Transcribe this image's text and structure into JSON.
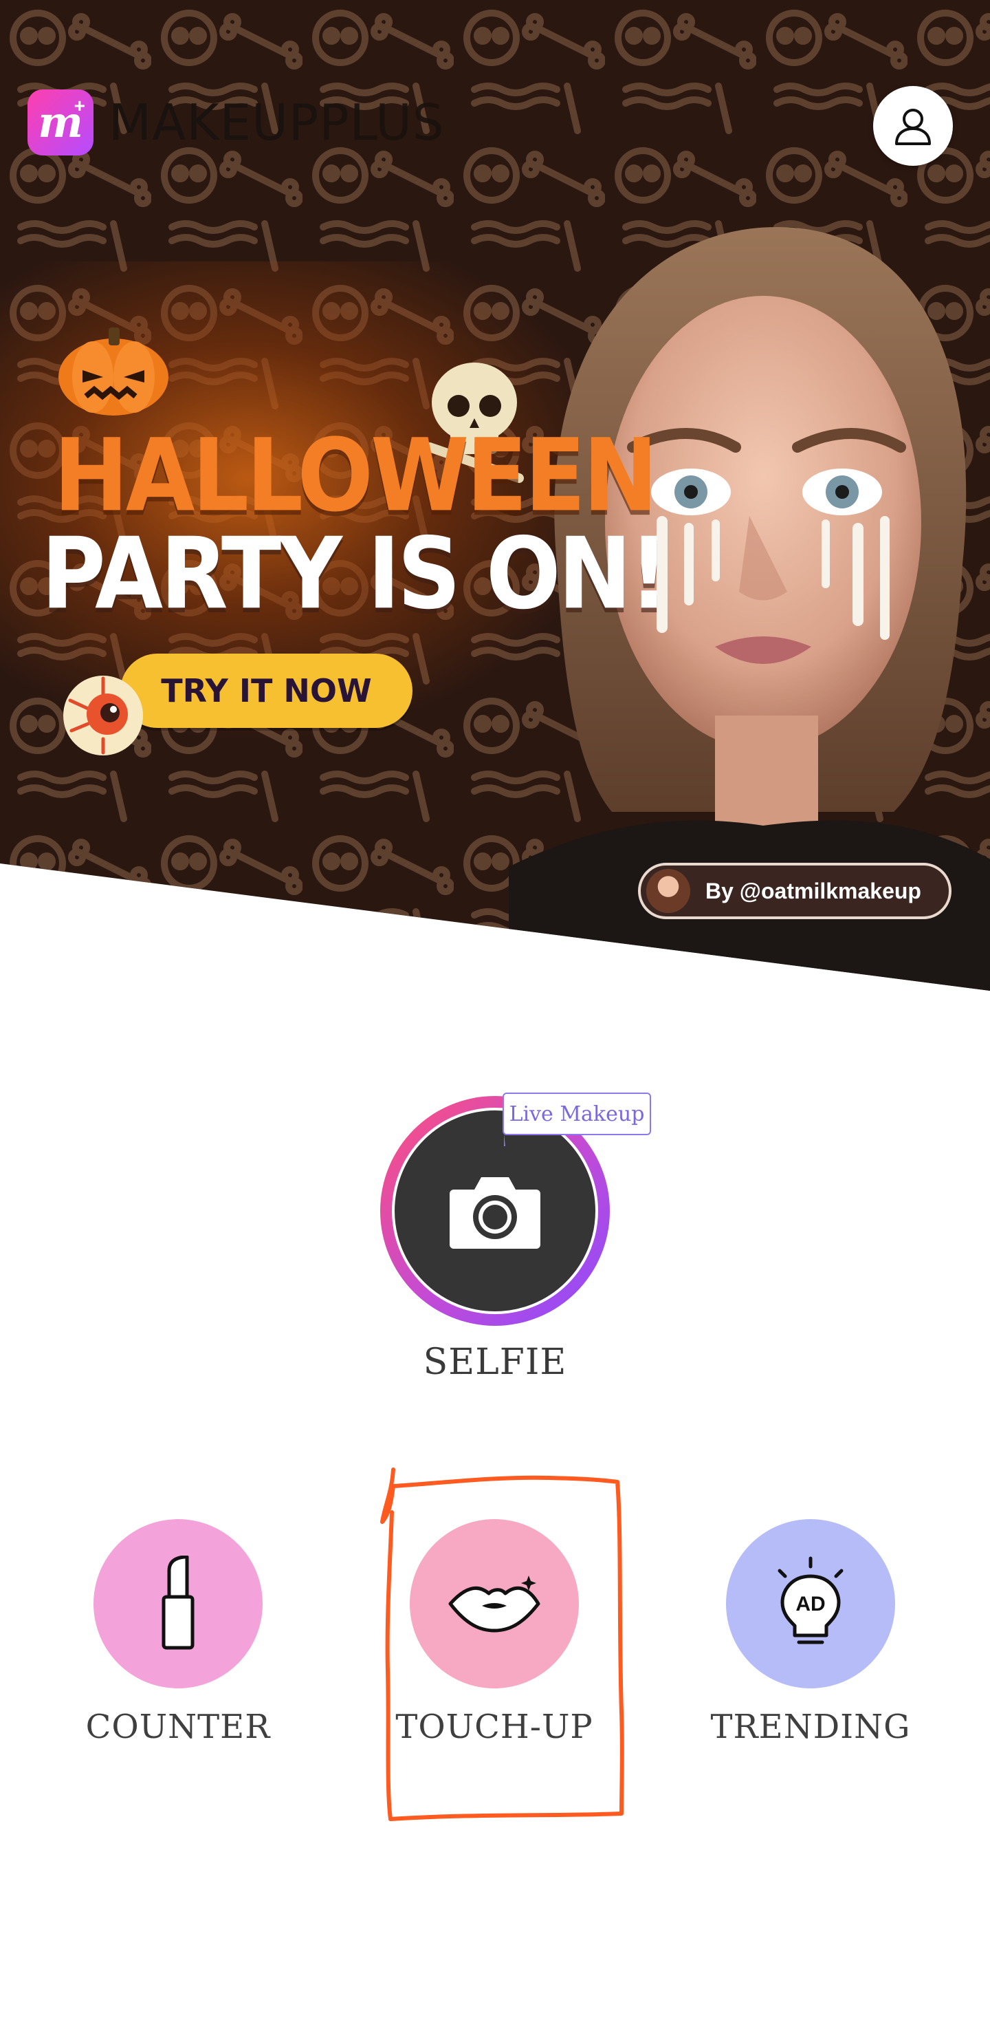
{
  "brand": {
    "mark": "m+",
    "name_bold": "MAKEUP",
    "name_light": "PLUS"
  },
  "banner": {
    "headline_1": "HALLOWEEN",
    "headline_2": "PARTY IS ON!",
    "cta_label": "TRY IT NOW",
    "credit": "By @oatmilkmakeup"
  },
  "selfie": {
    "label": "SELFIE",
    "badge": "Live Makeup"
  },
  "features": [
    {
      "label": "COUNTER",
      "icon": "lipstick-icon"
    },
    {
      "label": "TOUCH-UP",
      "icon": "lips-icon"
    },
    {
      "label": "TRENDING",
      "icon": "ad-lightbulb-icon",
      "icon_text": "AD"
    }
  ],
  "annotation": {
    "color": "#ff5a1f"
  },
  "colors": {
    "accent_pink": "#ff3fae",
    "accent_purple": "#8a4bff",
    "cta_yellow": "#f7c030",
    "halloween_orange": "#f47e25"
  }
}
